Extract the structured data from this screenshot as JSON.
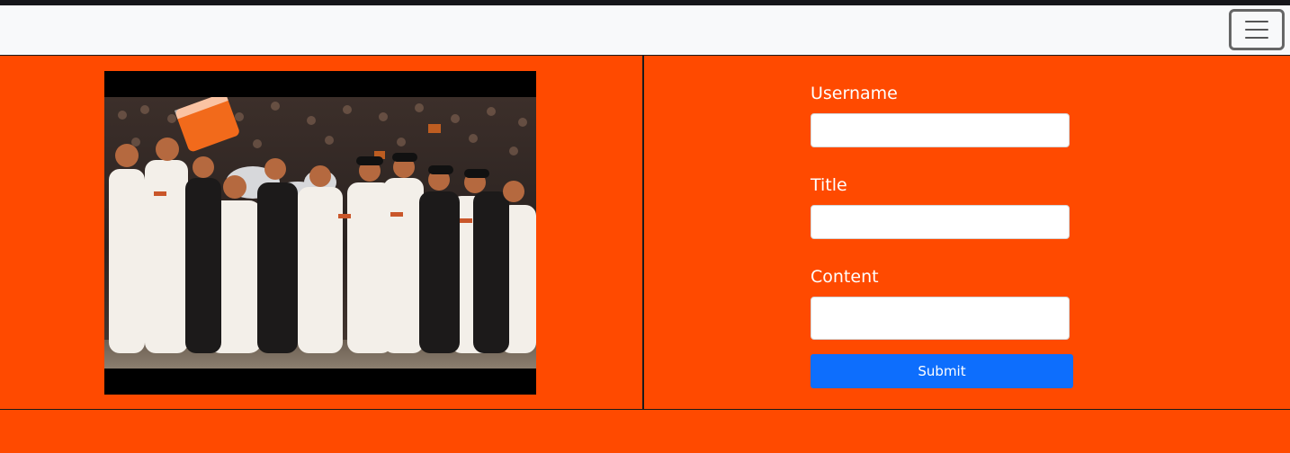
{
  "navbar": {
    "toggler_icon": "hamburger-menu-icon",
    "background_color": "#f8f9fa"
  },
  "theme": {
    "page_background": "#ff4a00",
    "accent": "#0d6efd"
  },
  "media": {
    "image_subject": "team-celebration-photo"
  },
  "form": {
    "username_label": "Username",
    "username_value": "",
    "title_label": "Title",
    "title_value": "",
    "content_label": "Content",
    "content_value": "",
    "submit_label": "Submit"
  }
}
